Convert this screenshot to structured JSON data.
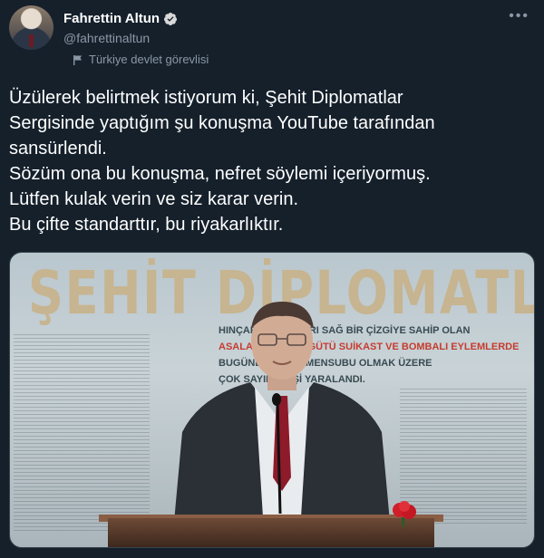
{
  "author": {
    "name": "Fahrettin Altun",
    "handle": "@fahrettinaltun",
    "label": "Türkiye devlet görevlisi",
    "verified": true
  },
  "more_icon": "more-horizontal-icon",
  "tweet": {
    "lines": [
      "Üzülerek belirtmek istiyorum ki, Şehit Diplomatlar",
      "Sergisinde yaptığım şu konuşma YouTube tarafından",
      "sansürlendi.",
      "Sözüm ona bu konuşma, nefret söylemi içeriyormuş.",
      "Lütfen kulak verin ve siz karar verin.",
      "Bu çifte standarttır, bu riyakarlıktır."
    ]
  },
  "media": {
    "banner_title": "ŞEHİT DİPLOMATLAR",
    "banner_lines": [
      "HINÇAR        YAKIN AŞIRI SAĞ BİR ÇİZGİYE SAHİP OLAN",
      "ASALA TERÖR ÖRGÜTÜ        SUİKAST VE BOMBALI EYLEMLERDE",
      "BUGÜNE        VE AİLE MENSUBU OLMAK ÜZERE",
      "                        ÇOK SAYIDA KİŞİ YARALANDI."
    ]
  },
  "colors": {
    "background": "#15202b",
    "text": "#ffffff",
    "secondary": "#8b98a5",
    "verified": "#1d9bf0",
    "banner_gold": "#c7b490",
    "banner_red": "#c63c2e"
  }
}
